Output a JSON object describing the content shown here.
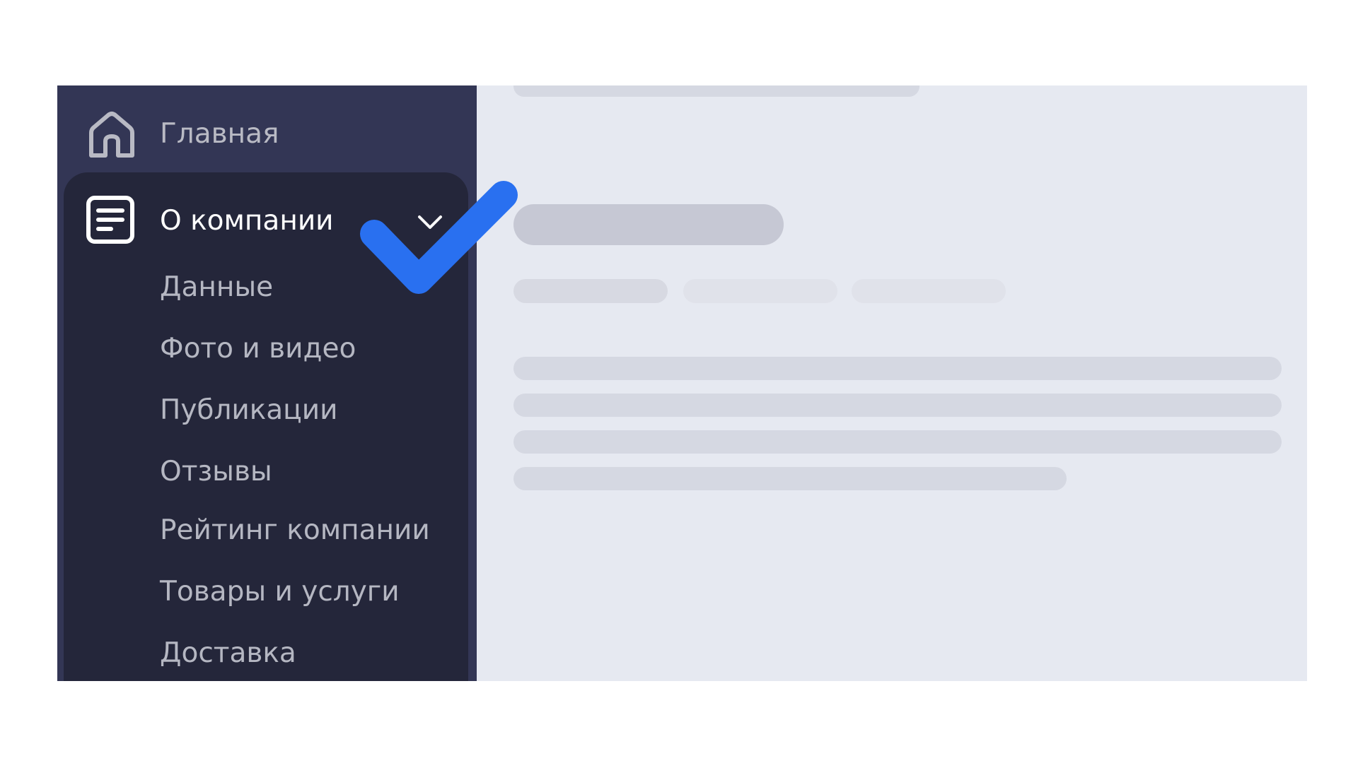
{
  "sidebar": {
    "home": {
      "label": "Главная",
      "icon": "home-icon"
    },
    "section": {
      "label": "О компании",
      "icon": "document-icon",
      "expanded": true,
      "items": [
        {
          "label": "Данные"
        },
        {
          "label": "Фото и видео"
        },
        {
          "label": "Публикации"
        },
        {
          "label": "Отзывы"
        },
        {
          "label": "Рейтинг компании"
        },
        {
          "label": "Товары и услуги"
        },
        {
          "label": "Доставка"
        }
      ]
    }
  },
  "overlay": {
    "icon": "checkmark-icon",
    "color": "#2970f0"
  },
  "colors": {
    "sidebar_bg": "#333655",
    "section_bg": "#24263a",
    "content_bg": "#e6e9f1",
    "skeleton": "#d5d8e2"
  }
}
